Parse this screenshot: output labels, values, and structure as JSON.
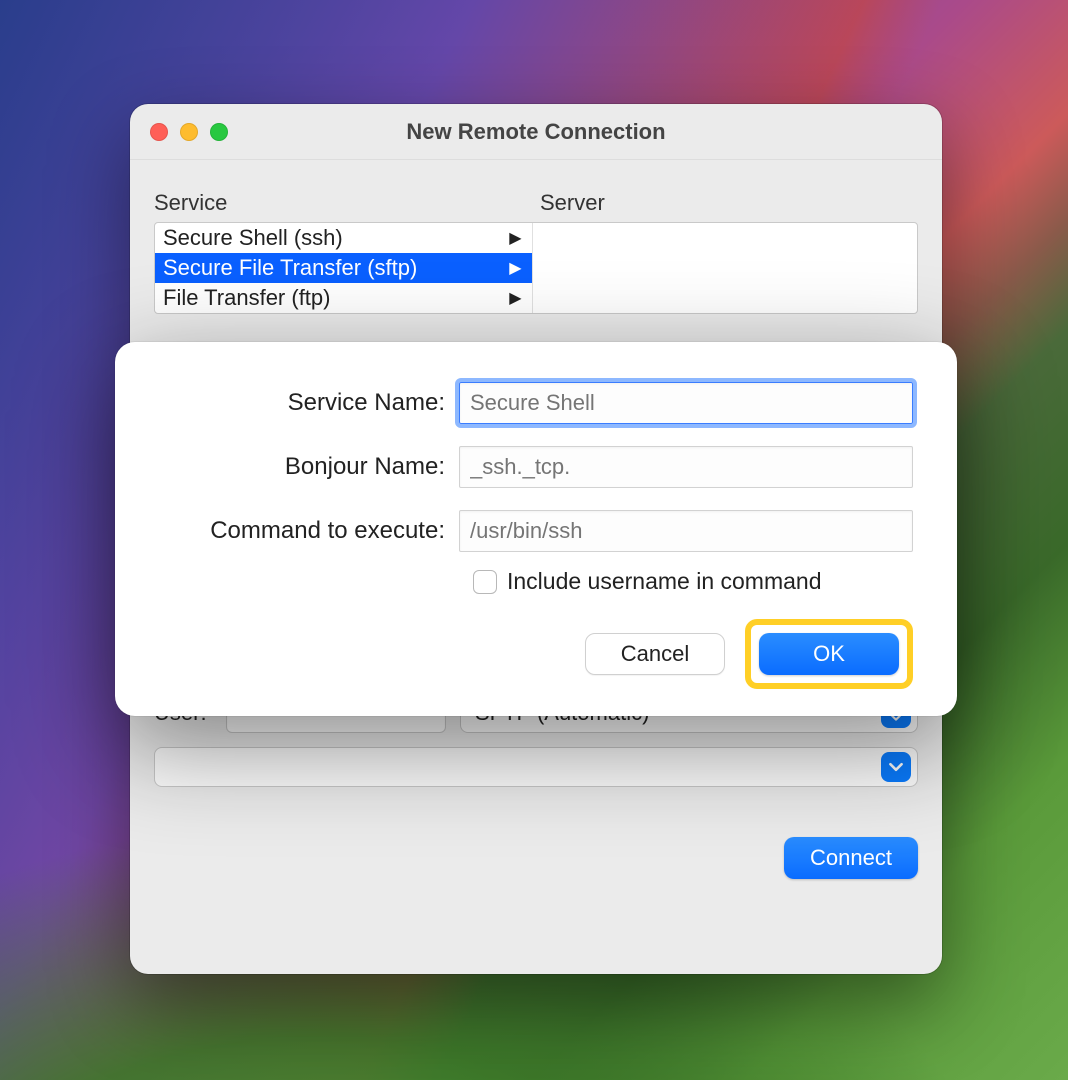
{
  "window": {
    "title": "New Remote Connection",
    "service_label": "Service",
    "server_label": "Server",
    "services": [
      {
        "label": "Secure Shell (ssh)",
        "selected": false
      },
      {
        "label": "Secure File Transfer (sftp)",
        "selected": true
      },
      {
        "label": "File Transfer (ftp)",
        "selected": false
      }
    ],
    "user_label": "User:",
    "user_value": "",
    "protocol_select": "SFTP (Automatic)",
    "connect_label": "Connect"
  },
  "sheet": {
    "service_name_label": "Service Name:",
    "service_name_placeholder": "Secure Shell",
    "bonjour_label": "Bonjour Name:",
    "bonjour_placeholder": "_ssh._tcp.",
    "command_label": "Command to execute:",
    "command_placeholder": "/usr/bin/ssh",
    "include_username_label": "Include username in command",
    "cancel_label": "Cancel",
    "ok_label": "OK"
  }
}
